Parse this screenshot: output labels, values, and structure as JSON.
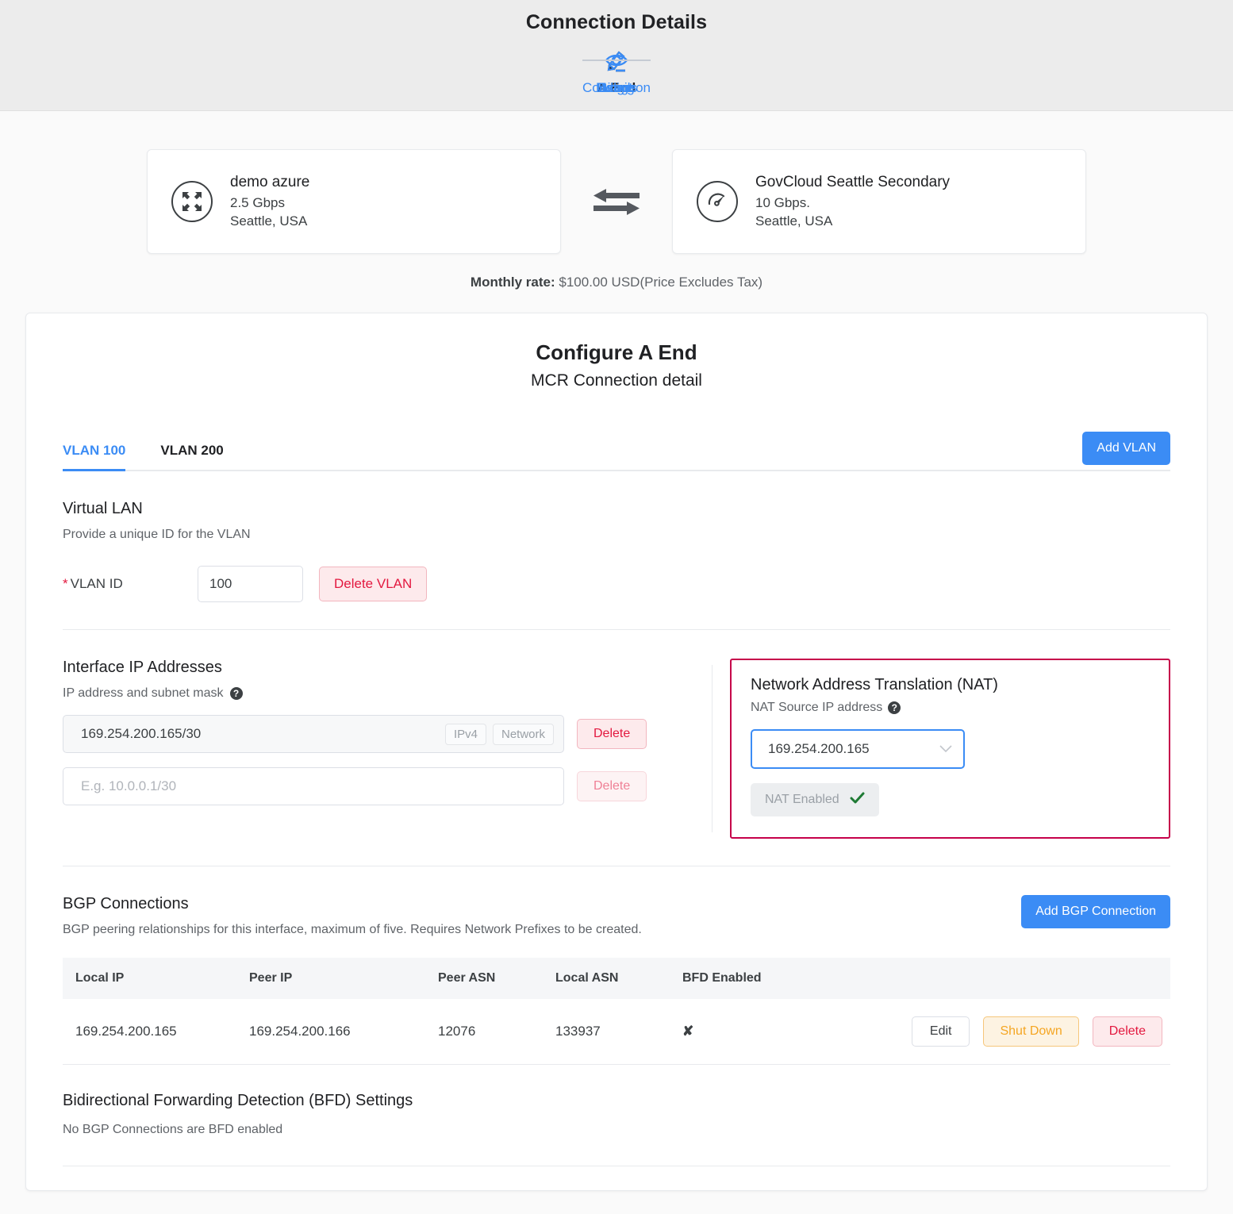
{
  "header": {
    "title": "Connection Details",
    "steps": [
      {
        "label": "Connection",
        "icon": "pencil-icon",
        "active": false
      },
      {
        "label": "A End",
        "icon": "pencil-icon",
        "active": true
      },
      {
        "label": "Azure",
        "icon": "pencil-icon",
        "active": false
      },
      {
        "label": "Details",
        "icon": "eye-icon",
        "active": false
      },
      {
        "label": "Logs",
        "icon": "eye-icon",
        "active": false
      },
      {
        "label": "Usage",
        "icon": "eye-icon",
        "active": false
      },
      {
        "label": "Billing",
        "icon": "eye-icon",
        "active": false
      }
    ]
  },
  "endpoints": {
    "a_end": {
      "icon": "mcr-arrows-icon",
      "name": "demo azure",
      "speed": "2.5 Gbps",
      "location": "Seattle, USA"
    },
    "b_end": {
      "icon": "speedometer-icon",
      "name": "GovCloud Seattle Secondary",
      "speed": "10 Gbps.",
      "location": "Seattle, USA"
    },
    "swap_icon": "exchange-arrows-icon",
    "monthly_rate_label": "Monthly rate:",
    "monthly_rate_value": "$100.00 USD(Price Excludes Tax)"
  },
  "panel": {
    "title": "Configure A End",
    "subtitle": "MCR Connection detail",
    "tabs": [
      {
        "label": "VLAN 100",
        "active": true
      },
      {
        "label": "VLAN 200",
        "active": false
      }
    ],
    "add_vlan_label": "Add VLAN"
  },
  "virtual_lan": {
    "heading": "Virtual LAN",
    "description": "Provide a unique ID for the VLAN",
    "vlan_id_label": "VLAN ID",
    "vlan_id_value": "100",
    "delete_vlan_label": "Delete VLAN"
  },
  "interface_ip": {
    "heading": "Interface IP Addresses",
    "sub_label": "IP address and subnet mask",
    "rows": [
      {
        "value": "169.254.200.165/30",
        "placeholder": "",
        "tags": [
          "IPv4",
          "Network"
        ],
        "delete_label": "Delete",
        "filled": true
      },
      {
        "value": "",
        "placeholder": "E.g. 10.0.0.1/30",
        "tags": [],
        "delete_label": "Delete",
        "filled": false
      }
    ]
  },
  "nat": {
    "heading": "Network Address Translation (NAT)",
    "sub_label": "NAT Source IP address",
    "selected_source_ip": "169.254.200.165",
    "options": [
      "169.254.200.165"
    ],
    "enabled_label": "NAT Enabled",
    "enabled_check": "✔",
    "border_color": "#c6004a"
  },
  "bgp": {
    "heading": "BGP Connections",
    "description": "BGP peering relationships for this interface, maximum of five. Requires Network Prefixes to be created.",
    "add_button_label": "Add BGP Connection",
    "columns": [
      "Local IP",
      "Peer IP",
      "Peer ASN",
      "Local ASN",
      "BFD Enabled"
    ],
    "rows": [
      {
        "local_ip": "169.254.200.165",
        "peer_ip": "169.254.200.166",
        "peer_asn": "12076",
        "local_asn": "133937",
        "bfd_enabled": "✘",
        "edit_label": "Edit",
        "shutdown_label": "Shut Down",
        "delete_label": "Delete"
      }
    ]
  },
  "bfd": {
    "heading": "Bidirectional Forwarding Detection (BFD) Settings",
    "empty_text": "No BGP Connections are BFD enabled"
  },
  "colors": {
    "accent_blue": "#3b8cf5",
    "danger_red": "#e3183f",
    "warn_orange": "#f5a623",
    "nat_border": "#c6004a",
    "check_green": "#1e7a34"
  }
}
